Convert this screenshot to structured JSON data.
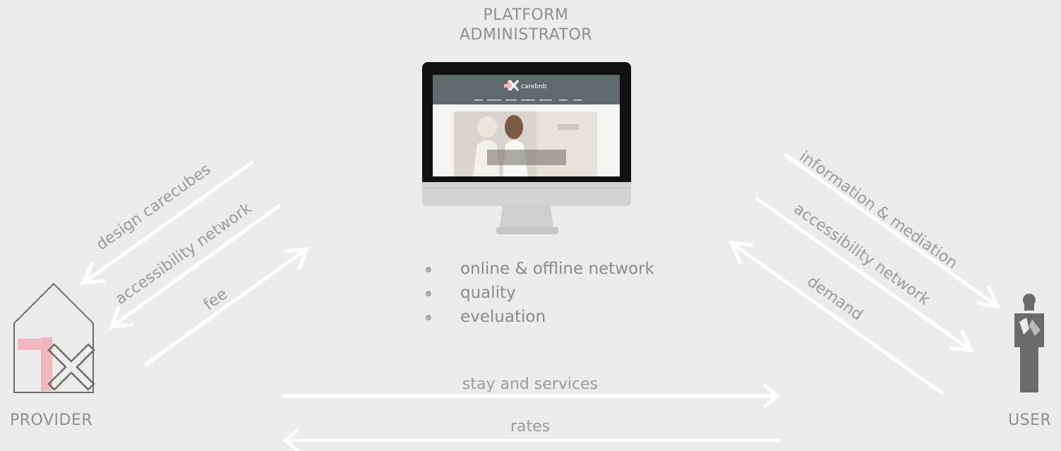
{
  "administrator": {
    "line1": "PLATFORM",
    "line2": "ADMINISTRATOR"
  },
  "provider": {
    "label": "PROVIDER"
  },
  "user": {
    "label": "USER"
  },
  "website": {
    "brand": "carebnb"
  },
  "features": [
    "online & offline network",
    "quality",
    "eveluation"
  ],
  "flows": {
    "design_carecubes": "design carecubes",
    "accessibility_network_left": "accessibility network",
    "fee": "fee",
    "information_mediation": "information & mediation",
    "accessibility_network_right": "accessibility network",
    "demand": "demand",
    "stay_services": "stay and services",
    "rates": "rates"
  },
  "colors": {
    "background": "#ececea",
    "arrow": "#ffffff",
    "label": "#9b9b9b",
    "brand_pink": "#f2b6be",
    "icon_gray": "#6b6b6b",
    "screen_header": "#5f6b6b"
  }
}
